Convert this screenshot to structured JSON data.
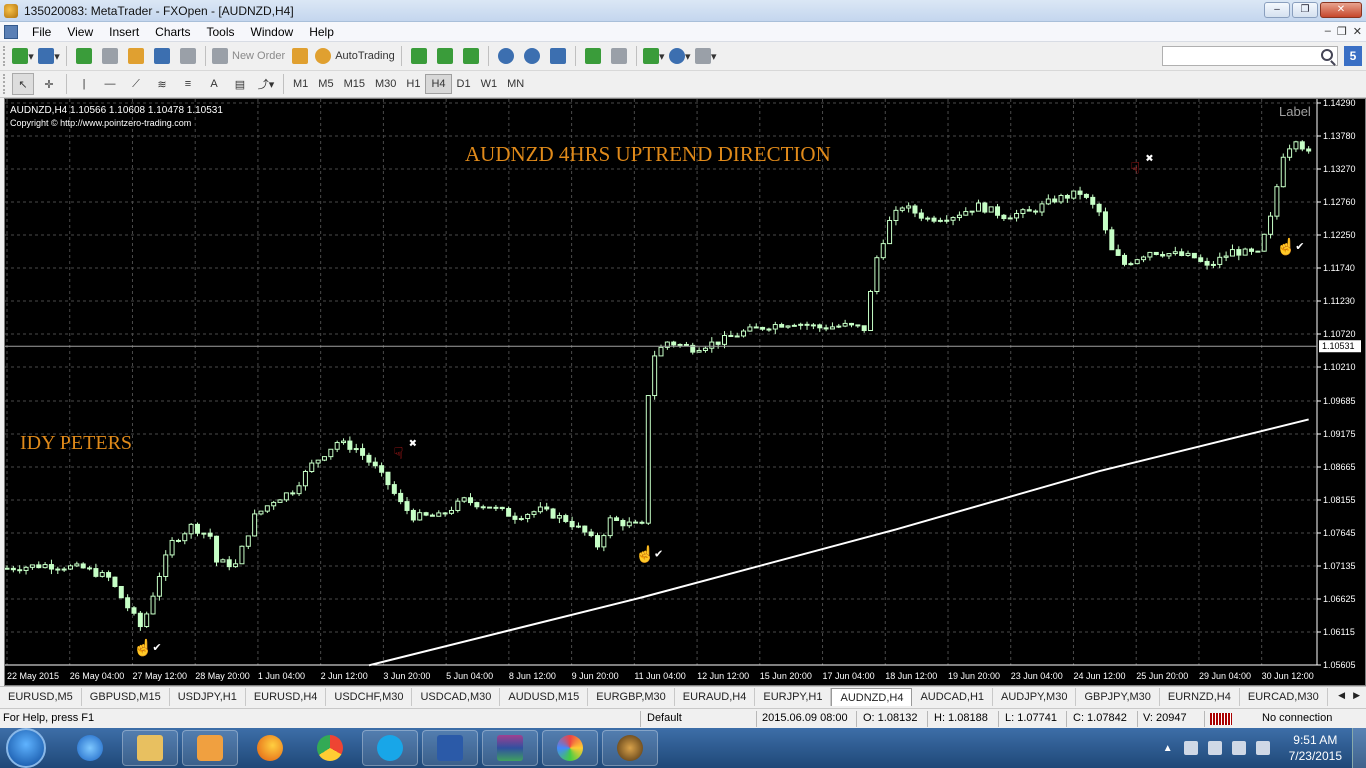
{
  "window": {
    "title": "135020083: MetaTrader - FXOpen - [AUDNZD,H4]"
  },
  "menu": [
    "File",
    "View",
    "Insert",
    "Charts",
    "Tools",
    "Window",
    "Help"
  ],
  "toolbar": {
    "new_order_label": "New Order",
    "autotrading_label": "AutoTrading"
  },
  "timeframes": [
    "M1",
    "M5",
    "M15",
    "M30",
    "H1",
    "H4",
    "D1",
    "W1",
    "MN"
  ],
  "active_timeframe": "H4",
  "chart": {
    "header_line": "AUDNZD,H4  1.10566 1.10608 1.10478 1.10531",
    "copyright": "Copyright © http://www.pointzero-trading.com",
    "annotation_title": "AUDNZD 4HRS UPTREND DIRECTION",
    "annotation_author": "IDY PETERS",
    "label_text": "Label",
    "current_price_label": "1.10531",
    "colors": {
      "background": "#000000",
      "grid": "#4a4a4a",
      "bull_candle": "#c6ffc6",
      "bear_candle": "#c6ffc6",
      "annotation": "#e08a1a",
      "ma_line": "#ffffff",
      "sell_arrow": "#e02020",
      "buy_arrow": "#40c040"
    },
    "price_ticks": [
      "1.14290",
      "1.13780",
      "1.13270",
      "1.12760",
      "1.12250",
      "1.11740",
      "1.11230",
      "1.10720",
      "1.10210",
      "1.09685",
      "1.09175",
      "1.08665",
      "1.08155",
      "1.07645",
      "1.07135",
      "1.06625",
      "1.06115",
      "1.05605"
    ],
    "time_ticks": [
      "22 May 2015",
      "26 May 04:00",
      "27 May 12:00",
      "28 May 20:00",
      "1 Jun 04:00",
      "2 Jun 12:00",
      "3 Jun 20:00",
      "5 Jun 04:00",
      "8 Jun 12:00",
      "9 Jun 20:00",
      "11 Jun 04:00",
      "12 Jun 12:00",
      "15 Jun 20:00",
      "17 Jun 04:00",
      "18 Jun 12:00",
      "19 Jun 20:00",
      "23 Jun 04:00",
      "24 Jun 12:00",
      "25 Jun 20:00",
      "29 Jun 04:00",
      "30 Jun 12:00"
    ]
  },
  "chart_data": {
    "type": "candlestick",
    "symbol": "AUDNZD",
    "timeframe": "H4",
    "ylim": [
      1.05605,
      1.1429
    ],
    "last_price": 1.10531,
    "close_path": [
      [
        0,
        1.071
      ],
      [
        6,
        1.0715
      ],
      [
        12,
        1.071
      ],
      [
        16,
        1.0695
      ],
      [
        19,
        1.065
      ],
      [
        21,
        1.062
      ],
      [
        22,
        1.064
      ],
      [
        24,
        1.07
      ],
      [
        26,
        1.075
      ],
      [
        29,
        1.0775
      ],
      [
        32,
        1.076
      ],
      [
        33,
        1.072
      ],
      [
        36,
        1.0715
      ],
      [
        39,
        1.079
      ],
      [
        42,
        1.0815
      ],
      [
        45,
        1.083
      ],
      [
        48,
        1.087
      ],
      [
        52,
        1.0905
      ],
      [
        55,
        1.0895
      ],
      [
        58,
        1.0865
      ],
      [
        60,
        1.084
      ],
      [
        62,
        1.081
      ],
      [
        64,
        1.079
      ],
      [
        68,
        1.079
      ],
      [
        72,
        1.0815
      ],
      [
        76,
        1.0805
      ],
      [
        80,
        1.079
      ],
      [
        84,
        1.08
      ],
      [
        88,
        1.0785
      ],
      [
        91,
        1.0765
      ],
      [
        93,
        1.0745
      ],
      [
        95,
        1.0785
      ],
      [
        97,
        1.078
      ],
      [
        100,
        1.0775
      ],
      [
        101,
        1.098
      ],
      [
        102,
        1.104
      ],
      [
        104,
        1.106
      ],
      [
        108,
        1.105
      ],
      [
        112,
        1.106
      ],
      [
        116,
        1.1075
      ],
      [
        120,
        1.1085
      ],
      [
        124,
        1.109
      ],
      [
        128,
        1.1082
      ],
      [
        132,
        1.1085
      ],
      [
        135,
        1.108
      ],
      [
        137,
        1.119
      ],
      [
        139,
        1.1245
      ],
      [
        141,
        1.127
      ],
      [
        145,
        1.125
      ],
      [
        149,
        1.1255
      ],
      [
        153,
        1.127
      ],
      [
        157,
        1.1255
      ],
      [
        161,
        1.126
      ],
      [
        165,
        1.128
      ],
      [
        169,
        1.129
      ],
      [
        172,
        1.126
      ],
      [
        174,
        1.12
      ],
      [
        176,
        1.118
      ],
      [
        180,
        1.12
      ],
      [
        184,
        1.1195
      ],
      [
        187,
        1.119
      ],
      [
        189,
        1.1175
      ],
      [
        193,
        1.12
      ],
      [
        197,
        1.1195
      ],
      [
        199,
        1.125
      ],
      [
        201,
        1.135
      ],
      [
        203,
        1.1375
      ],
      [
        205,
        1.135
      ]
    ],
    "ma_path": [
      [
        57,
        1.056
      ],
      [
        100,
        1.0665
      ],
      [
        140,
        1.077
      ],
      [
        172,
        1.086
      ],
      [
        205,
        1.094
      ]
    ]
  },
  "tabs": [
    "EURUSD,M5",
    "GBPUSD,M15",
    "USDJPY,H1",
    "EURUSD,H4",
    "USDCHF,M30",
    "USDCAD,M30",
    "AUDUSD,M15",
    "EURGBP,M30",
    "EURAUD,H4",
    "EURJPY,H1",
    "AUDNZD,H4",
    "AUDCAD,H1",
    "AUDJPY,M30",
    "GBPJPY,M30",
    "EURNZD,H4",
    "EURCAD,M30"
  ],
  "active_tab": "AUDNZD,H4",
  "status": {
    "help": "For Help, press F1",
    "profile": "Default",
    "time": "2015.06.09 08:00",
    "open": "O: 1.08132",
    "high": "H: 1.08188",
    "low": "L: 1.07741",
    "close": "C: 1.07842",
    "volume": "V: 20947",
    "connection": "No connection"
  },
  "taskbar": {
    "time": "9:51 AM",
    "date": "7/23/2015"
  }
}
